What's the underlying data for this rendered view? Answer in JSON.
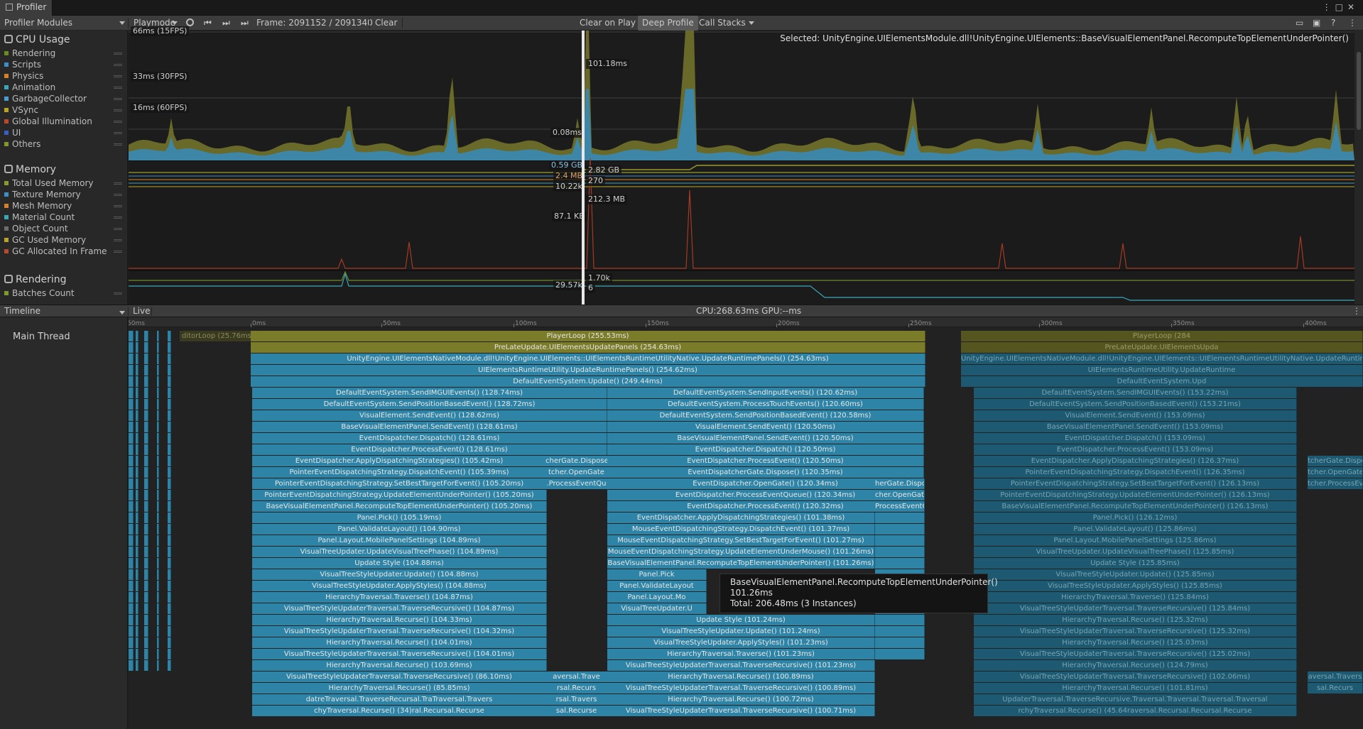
{
  "window": {
    "title": "Profiler"
  },
  "toolbar": {
    "modules_label": "Profiler Modules",
    "playmode_label": "Playmode",
    "frame_label": "Frame: 2091152 / 2091340",
    "clear_label": "Clear",
    "clear_on_play_label": "Clear on Play",
    "deep_profile_label": "Deep Profile",
    "call_stacks_label": "Call Stacks"
  },
  "selected_text": "Selected: UnityEngine.UIElementsModule.dll!UnityEngine.UIElements::BaseVisualElementPanel.RecomputeTopElementUnderPointer()",
  "modules": [
    {
      "title": "CPU Usage",
      "legend": [
        {
          "label": "Rendering",
          "color": "#6b8a1f"
        },
        {
          "label": "Scripts",
          "color": "#3e8fc7"
        },
        {
          "label": "Physics",
          "color": "#d4812a"
        },
        {
          "label": "Animation",
          "color": "#3aa6b8"
        },
        {
          "label": "GarbageCollector",
          "color": "#4a9bcf"
        },
        {
          "label": "VSync",
          "color": "#b7a52a"
        },
        {
          "label": "Global Illumination",
          "color": "#b64a2e"
        },
        {
          "label": "UI",
          "color": "#3b5fbf"
        },
        {
          "label": "Others",
          "color": "#7f9a2c"
        }
      ]
    },
    {
      "title": "Memory",
      "legend": [
        {
          "label": "Total Used Memory",
          "color": "#8a9a2c"
        },
        {
          "label": "Texture Memory",
          "color": "#3e8fc7"
        },
        {
          "label": "Mesh Memory",
          "color": "#d4812a"
        },
        {
          "label": "Material Count",
          "color": "#3aa6b8"
        },
        {
          "label": "Object Count",
          "color": "#6d6d6d"
        },
        {
          "label": "GC Used Memory",
          "color": "#b7a52a"
        },
        {
          "label": "GC Allocated In Frame",
          "color": "#b64a2e"
        }
      ]
    },
    {
      "title": "Rendering",
      "legend": [
        {
          "label": "Batches Count",
          "color": "#7f9a2c"
        }
      ]
    }
  ],
  "chart_labels": {
    "fps15": "66ms (15FPS)",
    "fps30": "33ms (30FPS)",
    "fps60": "16ms (60FPS)",
    "spike": "101.18ms",
    "v008": "0.08ms",
    "v059": "0.59 GB",
    "v24": "2.4 MB",
    "v1022": "10.22k",
    "v871": "87.1 KB",
    "v282": "2.82 GB",
    "v270": "270",
    "v2123": "212.3 MB",
    "v2957": "29.57k",
    "v170": "1.70k",
    "v6": "6"
  },
  "timeline": {
    "view_label": "Timeline",
    "live_label": "Live",
    "cpu_gpu": "CPU:268.63ms   GPU:--ms",
    "thread": "Main Thread",
    "ticks": [
      "0ms",
      "50ms",
      "100ms",
      "150ms",
      "200ms",
      "250ms",
      "300ms",
      "350ms",
      "400ms"
    ],
    "prev_ticks": [
      "50ms"
    ],
    "editor_loop": "ditorLoop (25.76ms)"
  },
  "tooltip": {
    "line1": "BaseVisualElementPanel.RecomputeTopElementUnderPointer()",
    "line2": "101.26ms",
    "line3": "Total: 206.48ms (3 Instances)"
  },
  "full_rows": [
    "PlayerLoop (255.53ms)",
    "PreLateUpdate.UIElementsUpdatePanels (254.63ms)",
    "UnityEngine.UIElementsNativeModule.dll!UnityEngine.UIElements::UIElementsRuntimeUtilityNative.UpdateRuntimePanels() (254.63ms)",
    "UIElementsRuntimeUtility.UpdateRuntimePanels() (254.62ms)",
    "DefaultEventSystem.Update() (249.44ms)"
  ],
  "left_rows": [
    "DefaultEventSystem.SendIMGUIEvents() (128.74ms)",
    "DefaultEventSystem.SendPositionBasedEvent() (128.72ms)",
    "VisualElement.SendEvent() (128.62ms)",
    "BaseVisualElementPanel.SendEvent() (128.61ms)",
    "EventDispatcher.Dispatch() (128.61ms)",
    "EventDispatcher.ProcessEvent() (128.61ms)",
    "EventDispatcher.ApplyDispatchingStrategies() (105.42ms)",
    "PointerEventDispatchingStrategy.DispatchEvent() (105.39ms)",
    "PointerEventDispatchingStrategy.SetBestTargetForEvent() (105.20ms)",
    "PointerEventDispatchingStrategy.UpdateElementUnderPointer() (105.20ms)",
    "BaseVisualElementPanel.RecomputeTopElementUnderPointer() (105.20ms)",
    "Panel.Pick() (105.19ms)",
    "Panel.ValidateLayout() (104.90ms)",
    "Panel.Layout.MobilePanelSettings (104.89ms)",
    "VisualTreeUpdater.UpdateVisualTreePhase() (104.89ms)",
    "Update Style (104.88ms)",
    "VisualTreeStyleUpdater.Update() (104.88ms)",
    "VisualTreeStyleUpdater.ApplyStyles() (104.88ms)",
    "HierarchyTraversal.Traverse() (104.87ms)",
    "VisualTreeStyleUpdaterTraversal.TraverseRecursive() (104.87ms)",
    "HierarchyTraversal.Recurse() (104.33ms)",
    "VisualTreeStyleUpdaterTraversal.TraverseRecursive() (104.32ms)",
    "HierarchyTraversal.Recurse() (104.01ms)",
    "VisualTreeStyleUpdaterTraversal.TraverseRecursive() (104.01ms)",
    "HierarchyTraversal.Recurse() (103.69ms)",
    "VisualTreeStyleUpdaterTraversal.TraverseRecursive() (86.10ms)",
    "HierarchyTraversal.Recurse() (85.85ms)",
    "datreTraversal.TraverseRecursal.TraTraversal.Travers",
    "chyTraversal.Recurse() (34)ral.Recursal.Recurse"
  ],
  "mid_frag": [
    "",
    "",
    "",
    "",
    "",
    "",
    "cherGate.Dispose",
    "tcher.OpenGate",
    ".ProcessEventQu",
    "",
    "",
    "",
    "",
    "",
    "",
    "",
    "",
    "",
    "",
    "",
    "",
    "",
    "",
    "",
    "",
    "aversal.Trave",
    "rsal.Recurs",
    "rsal.Travers",
    "sal.Recurse"
  ],
  "mid_rows": [
    "DefaultEventSystem.SendInputEvents() (120.62ms)",
    "DefaultEventSystem.ProcessTouchEvents() (120.60ms)",
    "DefaultEventSystem.SendPositionBasedEvent() (120.58ms)",
    "VisualElement.SendEvent() (120.50ms)",
    "BaseVisualElementPanel.SendEvent() (120.50ms)",
    "EventDispatcher.Dispatch() (120.50ms)",
    "EventDispatcher.ProcessEvent() (120.50ms)",
    "EventDispatcherGate.Dispose() (120.35ms)",
    "EventDispatcher.OpenGate() (120.34ms)",
    "EventDispatcher.ProcessEventQueue() (120.34ms)",
    "EventDispatcher.ProcessEvent() (120.32ms)",
    "EventDispatcher.ApplyDispatchingStrategies() (101.38ms)",
    "MouseEventDispatchingStrategy.DispatchEvent() (101.37ms)",
    "MouseEventDispatchingStrategy.SetBestTargetForEvent() (101.27ms)",
    "MouseEventDispatchingStrategy.UpdateElementUnderMouse() (101.26ms)",
    "BaseVisualElementPanel.RecomputeTopElementUnderPointer() (101.26ms)",
    "Panel.Pick",
    "Panel.ValidateLayout",
    "Panel.Layout.Mo",
    "VisualTreeUpdater.U",
    "Update Style (101.24ms)",
    "VisualTreeStyleUpdater.Update() (101.24ms)",
    "VisualTreeStyleUpdater.ApplyStyles() (101.23ms)",
    "HierarchyTraversal.Traverse() (101.23ms)",
    "VisualTreeStyleUpdaterTraversal.TraverseRecursive() (101.23ms)",
    "HierarchyTraversal.Recurse() (100.89ms)",
    "VisualTreeStyleUpdaterTraversal.TraverseRecursive() (100.89ms)",
    "HierarchyTraversal.Recurse() (100.72ms)",
    "VisualTreeStyleUpdaterTraversal.TraverseRecursive() (100.71ms)"
  ],
  "mid_right_frag": [
    "",
    "",
    "",
    "",
    "",
    "",
    "",
    "",
    "herGate.Dispos",
    "cher.OpenGate",
    "ProcessEventQ"
  ],
  "ghost_top": [
    "PlayerLoop (284",
    "PreLateUpdate.UIElementsUpda",
    "UnityEngine.UIElementsNativeModule.dll!UnityEngine.UIElements::UIElementsRuntimeUtilityNative.UpdateRuntime",
    "UIElementsRuntimeUtility.UpdateRuntime",
    "DefaultEventSystem.Upd"
  ],
  "ghost_rows": [
    "DefaultEventSystem.SendIMGUIEvents() (153.22ms)",
    "DefaultEventSystem.SendPositionBasedEvent() (153.21ms)",
    "VisualElement.SendEvent() (153.09ms)",
    "BaseVisualElementPanel.SendEvent() (153.09ms)",
    "EventDispatcher.Dispatch() (153.09ms)",
    "EventDispatcher.ProcessEvent() (153.09ms)",
    "EventDispatcher.ApplyDispatchingStrategies() (126.37ms)",
    "PointerEventDispatchingStrategy.DispatchEvent() (126.35ms)",
    "PointerEventDispatchingStrategy.SetBestTargetForEvent() (126.13ms)",
    "PointerEventDispatchingStrategy.UpdateElementUnderPointer() (126.13ms)",
    "BaseVisualElementPanel.RecomputeTopElementUnderPointer() (126.13ms)",
    "Panel.Pick() (126.12ms)",
    "Panel.ValidateLayout() (125.86ms)",
    "Panel.Layout.MobilePanelSettings (125.86ms)",
    "VisualTreeUpdater.UpdateVisualTreePhase() (125.85ms)",
    "Update Style (125.85ms)",
    "VisualTreeStyleUpdater.Update() (125.85ms)",
    "VisualTreeStyleUpdater.ApplyStyles() (125.85ms)",
    "HierarchyTraversal.Traverse() (125.84ms)",
    "VisualTreeStyleUpdaterTraversal.TraverseRecursive() (125.84ms)",
    "HierarchyTraversal.Recurse() (125.32ms)",
    "VisualTreeStyleUpdaterTraversal.TraverseRecursive() (125.32ms)",
    "HierarchyTraversal.Recurse() (125.03ms)",
    "VisualTreeStyleUpdaterTraversal.TraverseRecursive() (125.02ms)",
    "HierarchyTraversal.Recurse() (124.79ms)",
    "VisualTreeStyleUpdaterTraversal.TraverseRecursive() (102.06ms)",
    "HierarchyTraversal.Recurse() (101.81ms)",
    "UpdaterTraversal.TraverseRecursive.Traversal.Traversal.Traversal.Traversal",
    "rchyTraversal.Recurse() (45.64raversal.Recursal.Recursal.Recurse"
  ],
  "ghost_right_frag": [
    "",
    "",
    "",
    "",
    "",
    "",
    "tcherGate.Dispo",
    "tcher.OpenGate",
    "tcher.ProcessEv",
    "",
    "",
    "",
    "",
    "",
    "",
    "",
    "",
    "",
    "",
    "",
    "",
    "",
    "",
    "",
    "",
    "aversal.Travers",
    "sal.Recurs"
  ]
}
